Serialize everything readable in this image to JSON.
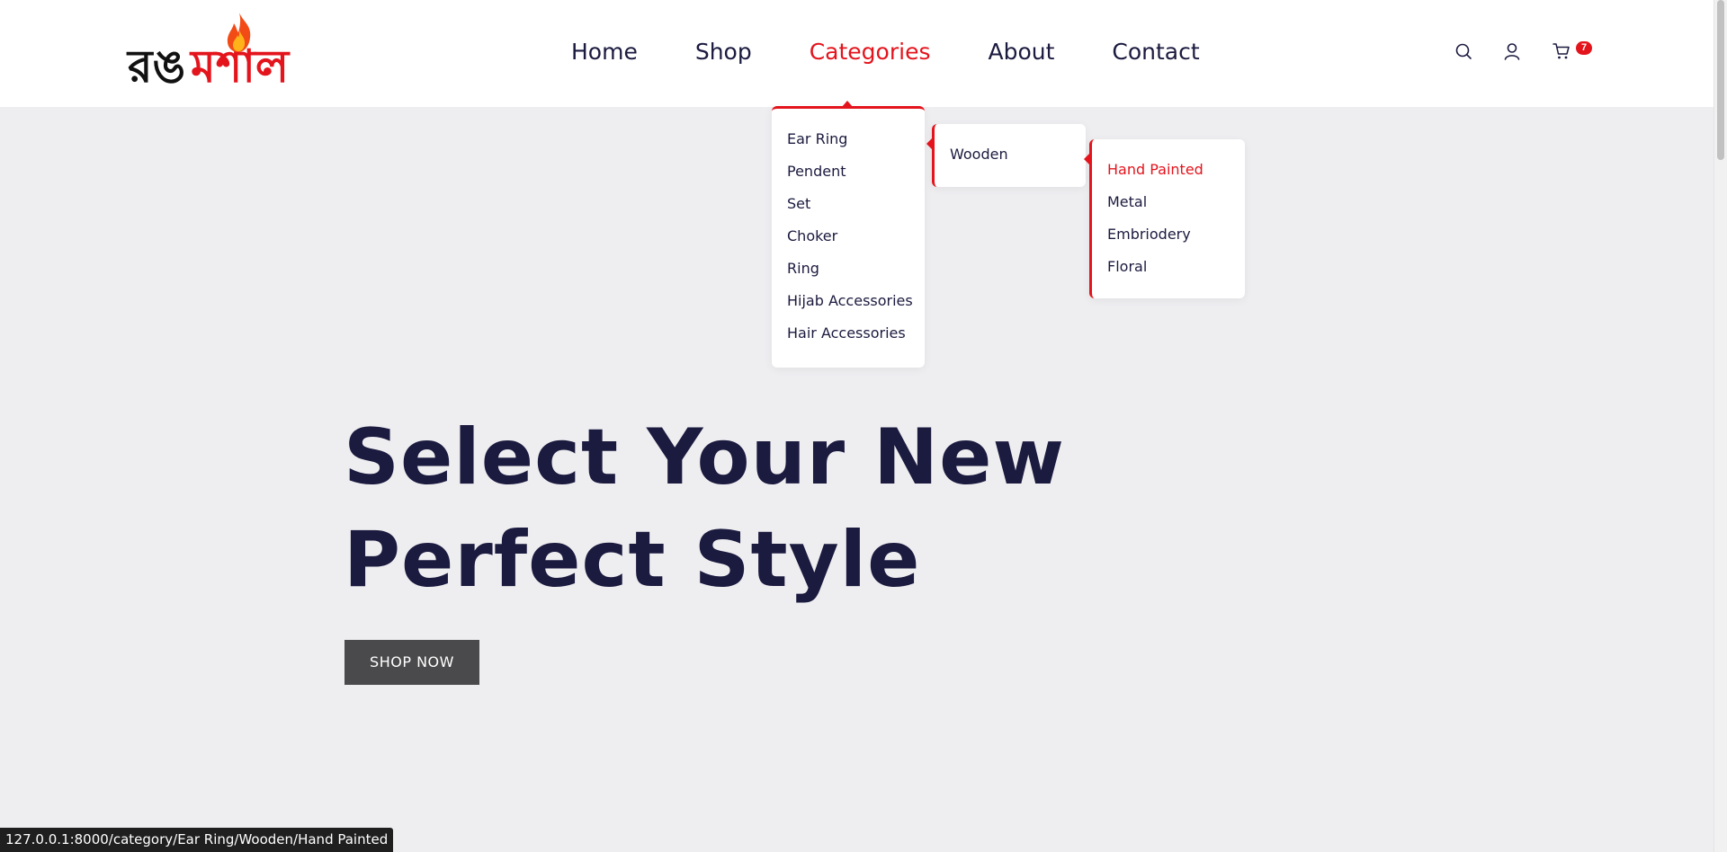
{
  "header": {
    "logo": {
      "text_black": "রঙ",
      "text_red": "মশাল"
    },
    "nav": [
      "Home",
      "Shop",
      "Categories",
      "About",
      "Contact"
    ],
    "active_nav": "Categories",
    "cart_count": "7",
    "icons": [
      "search-icon",
      "user-icon",
      "cart-icon"
    ]
  },
  "menus": {
    "level1": [
      "Ear Ring",
      "Pendent",
      "Set",
      "Choker",
      "Ring",
      "Hijab Accessories",
      "Hair Accessories"
    ],
    "level2": [
      "Wooden"
    ],
    "level3": [
      "Hand Painted",
      "Metal",
      "Embriodery",
      "Floral"
    ],
    "level3_highlighted": "Hand Painted"
  },
  "hero": {
    "title_line1": "Select Your New",
    "title_line2": "Perfect Style",
    "button_label": "SHOP NOW"
  },
  "status_bar": {
    "url": "127.0.0.1:8000/category/Ear Ring/Wooden/Hand Painted"
  },
  "colors": {
    "accent": "#e3141c",
    "text_dark": "#1b1a3f",
    "background": "#eeeef1",
    "button": "#4a4a4c"
  }
}
